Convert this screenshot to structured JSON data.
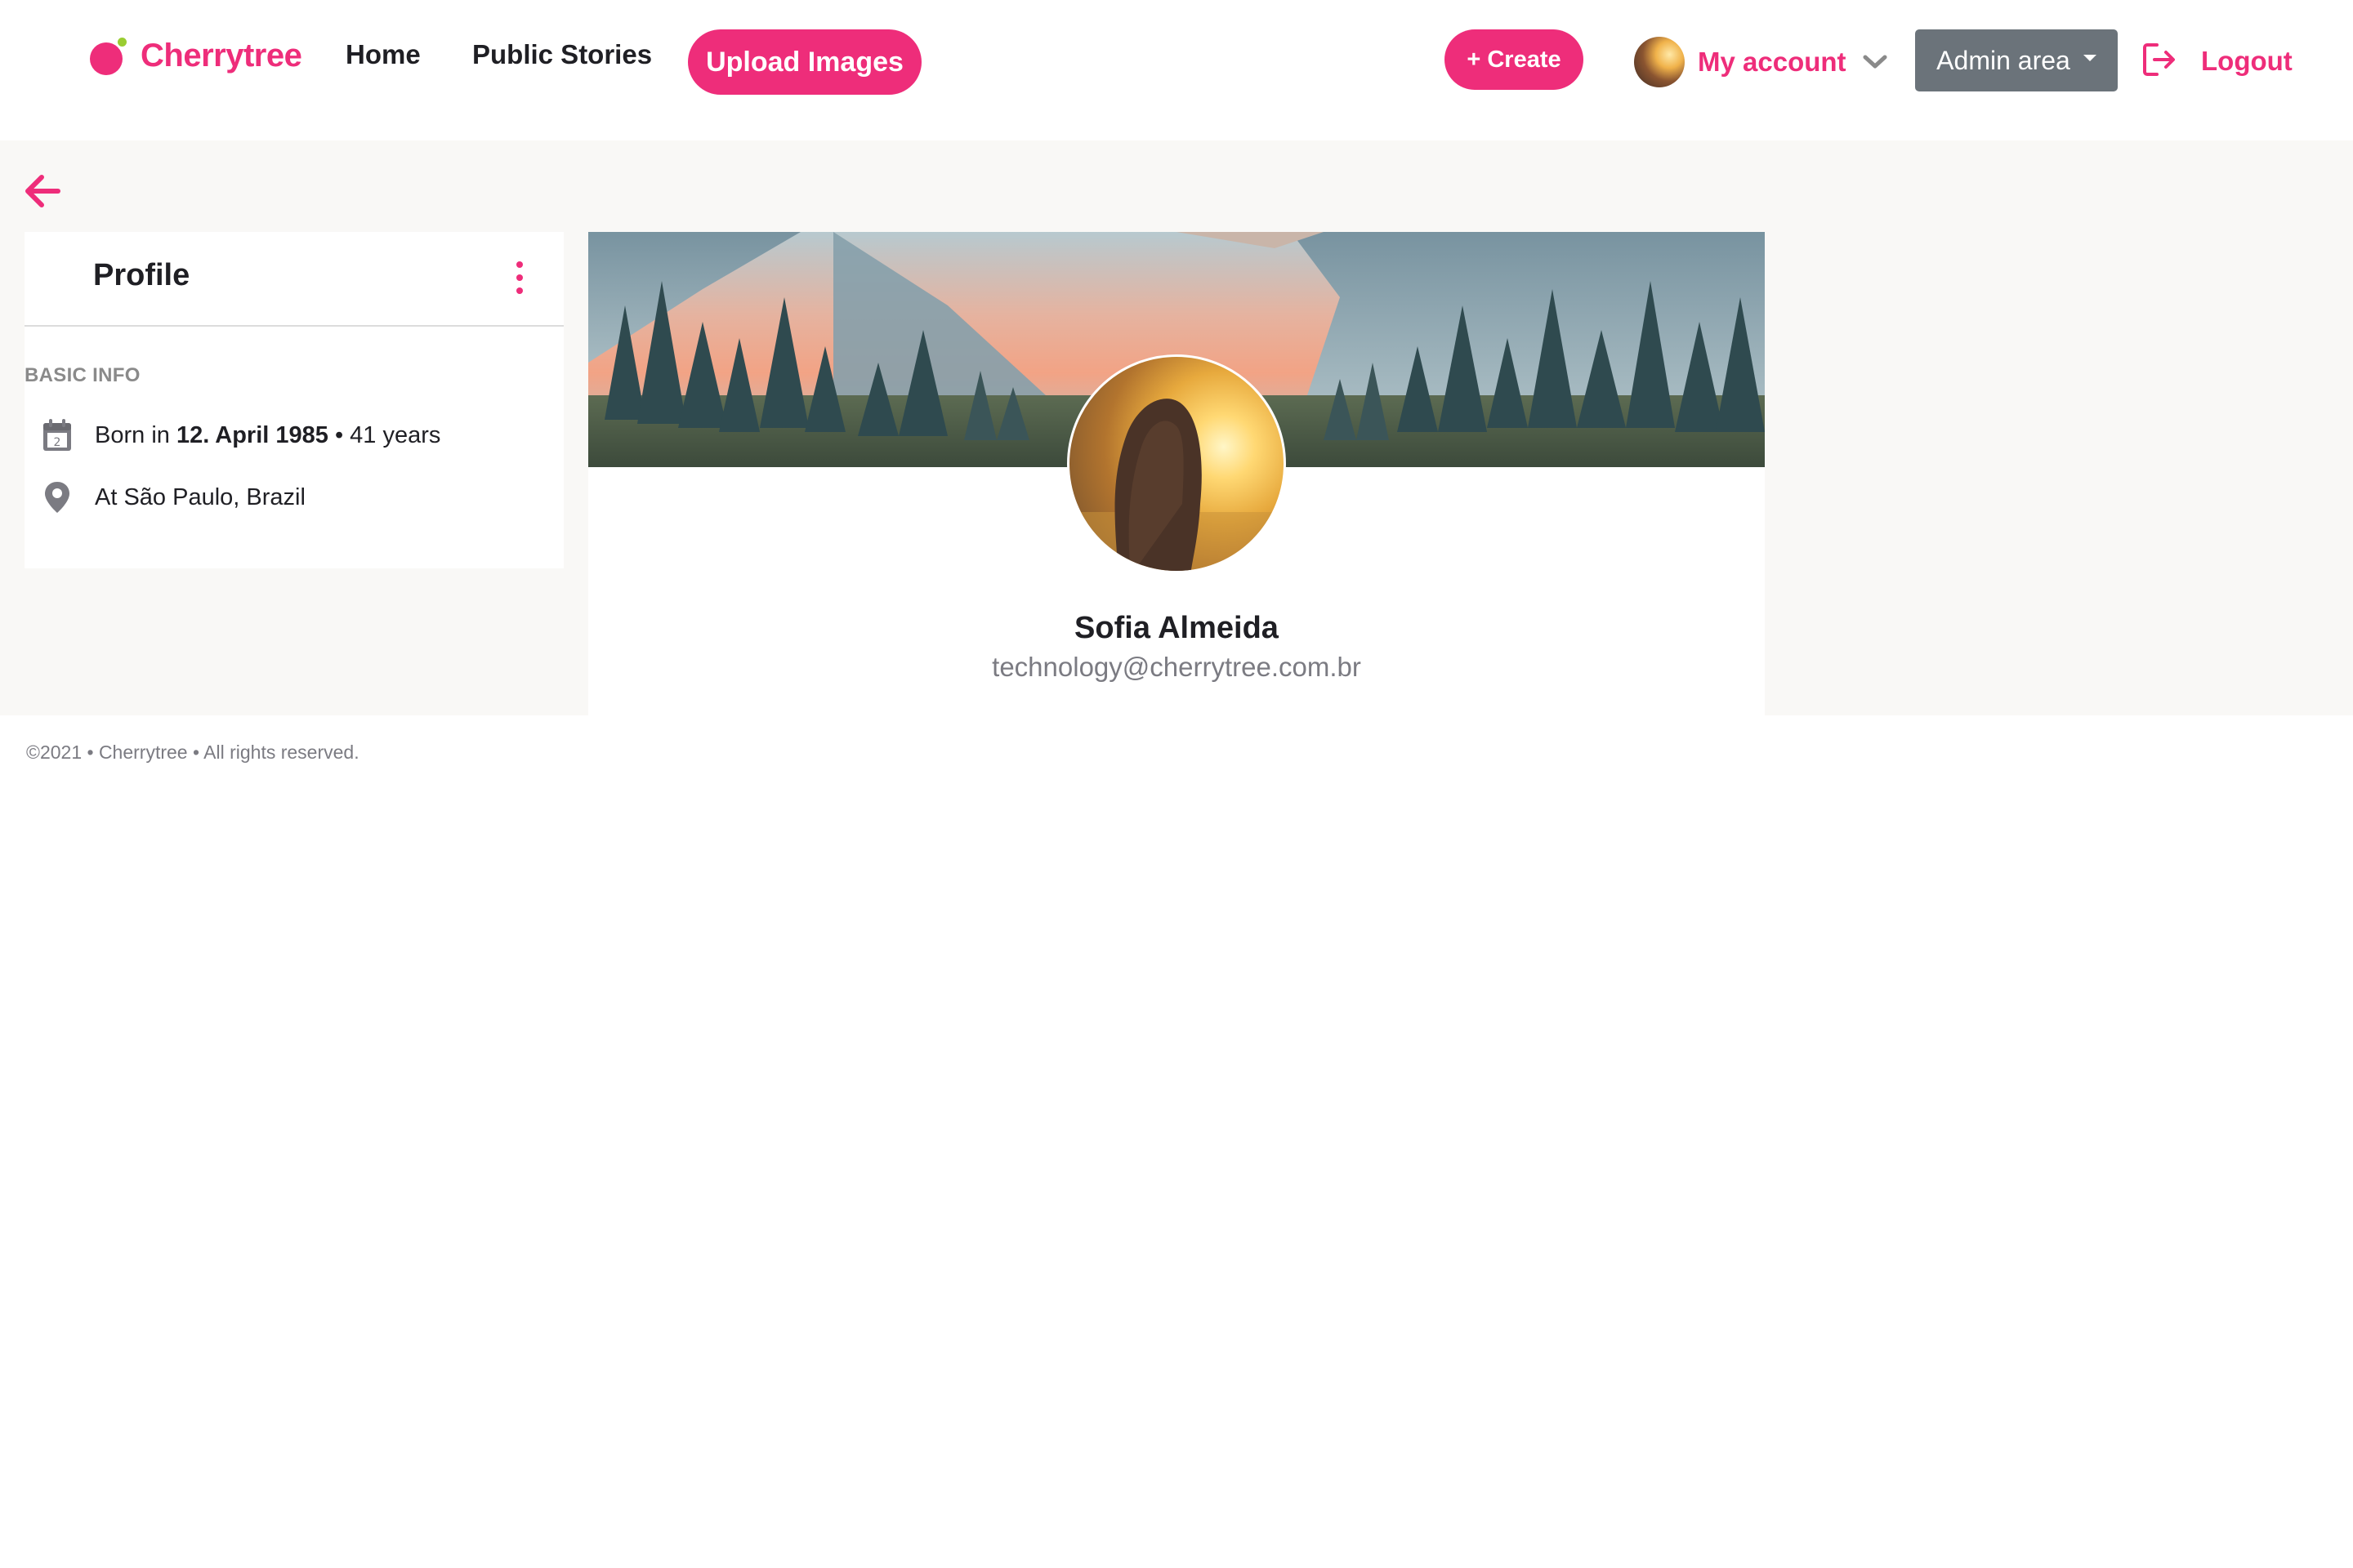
{
  "brand": {
    "name": "Cherrytree",
    "color": "#ee2d7a"
  },
  "nav": {
    "home": "Home",
    "public_stories": "Public Stories",
    "upload": "Upload Images",
    "create": "+ Create",
    "account": "My account",
    "admin": "Admin area",
    "logout": "Logout"
  },
  "icons": {
    "back": "arrow-left-icon",
    "menu": "kebab-menu-icon",
    "calendar": "calendar-icon",
    "location": "map-pin-icon",
    "chevron": "chevron-down-icon",
    "logout": "logout-icon"
  },
  "profile": {
    "title": "Profile",
    "section_label": "BASIC INFO",
    "born_prefix": "Born in",
    "born_date": "12. April 1985",
    "born_sep": "•",
    "age": "41 years",
    "location": "At São Paulo, Brazil",
    "name": "Sofia Almeida",
    "email": "technology@cherrytree.com.br"
  },
  "footer": {
    "text": "©2021 • Cherrytree • All rights reserved."
  },
  "colors": {
    "accent": "#ee2d7a",
    "admin_button": "#6b737a",
    "page_bg": "#f9f8f6",
    "muted": "#8a8a8a"
  }
}
